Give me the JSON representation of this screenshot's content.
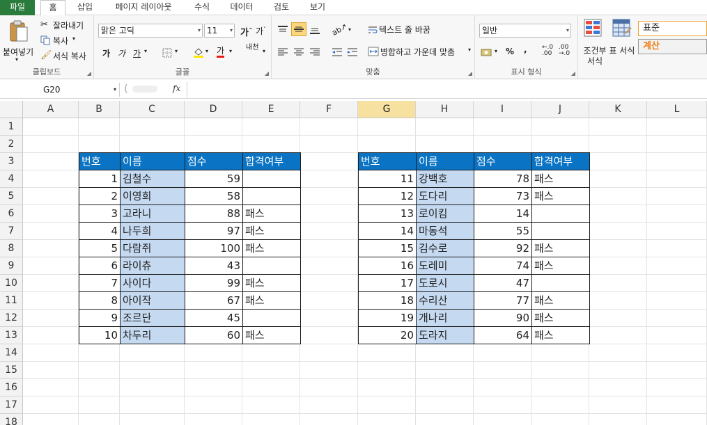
{
  "tabs": [
    "파일",
    "홈",
    "삽입",
    "페이지 레이아웃",
    "수식",
    "데이터",
    "검토",
    "보기"
  ],
  "ribbon": {
    "clipboard": {
      "paste": "붙여넣기",
      "cut": "잘라내기",
      "copy": "복사",
      "format_painter": "서식 복사",
      "label": "클립보드"
    },
    "font": {
      "name": "맑은 고딕",
      "size": "11",
      "bold": "가",
      "italic": "가",
      "underline": "가",
      "font_color_glyph": "가",
      "phonetic": "내천",
      "label": "글꼴"
    },
    "align": {
      "wrap": "텍스트 줄 바꿈",
      "merge": "병합하고 가운데 맞춤",
      "label": "맞춤"
    },
    "number": {
      "format": "일반",
      "percent": "%",
      "comma": ",",
      "inc_decimal": ".00",
      "dec_decimal": ".00",
      "label": "표시 형식"
    },
    "styles": {
      "conditional": "조건부 서식",
      "table": "표 서식",
      "standard": "표준",
      "calc": "계산"
    }
  },
  "formula_bar": {
    "name_box": "G20",
    "fx": "fx",
    "value": ""
  },
  "columns": [
    "A",
    "B",
    "C",
    "D",
    "E",
    "F",
    "G",
    "H",
    "I",
    "J",
    "K",
    "L"
  ],
  "selected_column": "G",
  "rows": [
    "1",
    "2",
    "3",
    "4",
    "5",
    "6",
    "7",
    "8",
    "9",
    "10",
    "11",
    "12",
    "13",
    "14",
    "15",
    "16",
    "17",
    "18"
  ],
  "table1": {
    "headers": [
      "번호",
      "이름",
      "점수",
      "합격여부"
    ],
    "rows": [
      [
        "1",
        "김철수",
        "59",
        ""
      ],
      [
        "2",
        "이영희",
        "58",
        ""
      ],
      [
        "3",
        "고라니",
        "88",
        "패스"
      ],
      [
        "4",
        "나두희",
        "97",
        "패스"
      ],
      [
        "5",
        "다람쥐",
        "100",
        "패스"
      ],
      [
        "6",
        "라이츄",
        "43",
        ""
      ],
      [
        "7",
        "사이다",
        "99",
        "패스"
      ],
      [
        "8",
        "아이작",
        "67",
        "패스"
      ],
      [
        "9",
        "조르단",
        "45",
        ""
      ],
      [
        "10",
        "차두리",
        "60",
        "패스"
      ]
    ]
  },
  "table2": {
    "headers": [
      "번호",
      "이름",
      "점수",
      "합격여부"
    ],
    "rows": [
      [
        "11",
        "강백호",
        "78",
        "패스"
      ],
      [
        "12",
        "도다리",
        "73",
        "패스"
      ],
      [
        "13",
        "로이킴",
        "14",
        ""
      ],
      [
        "14",
        "마동석",
        "55",
        ""
      ],
      [
        "15",
        "김수로",
        "92",
        "패스"
      ],
      [
        "16",
        "도레미",
        "74",
        "패스"
      ],
      [
        "17",
        "도로시",
        "47",
        ""
      ],
      [
        "18",
        "수리산",
        "77",
        "패스"
      ],
      [
        "19",
        "개나리",
        "90",
        "패스"
      ],
      [
        "20",
        "도라지",
        "64",
        "패스"
      ]
    ]
  },
  "colors": {
    "header_fill": "#0a73c3",
    "name_fill": "#c5d9f1",
    "file_tab": "#2a7c3d",
    "selected_header": "#f7e1a0"
  }
}
